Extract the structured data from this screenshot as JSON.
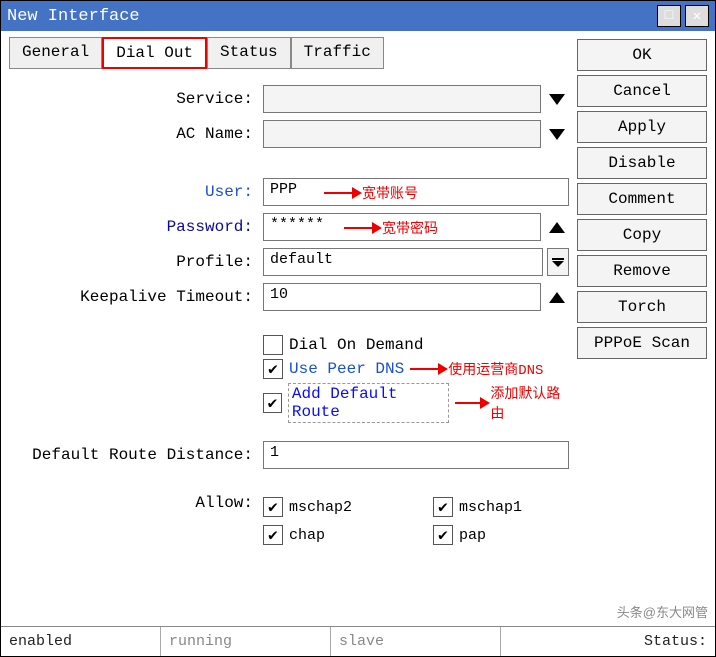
{
  "title": "New Interface",
  "tabs": [
    "General",
    "Dial Out",
    "Status",
    "Traffic"
  ],
  "active_tab": "Dial Out",
  "fields": {
    "service_label": "Service:",
    "service_value": "",
    "acname_label": "AC Name:",
    "acname_value": "",
    "user_label": "User:",
    "user_value": "PPP",
    "password_label": "Password:",
    "password_value": "******",
    "profile_label": "Profile:",
    "profile_value": "default",
    "keepalive_label": "Keepalive Timeout:",
    "keepalive_value": "10",
    "default_route_distance_label": "Default Route Distance:",
    "default_route_distance_value": "1",
    "allow_label": "Allow:"
  },
  "checkboxes": {
    "dial_on_demand": {
      "label": "Dial On Demand",
      "checked": false
    },
    "use_peer_dns": {
      "label": "Use Peer DNS",
      "checked": true
    },
    "add_default_route": {
      "label": "Add Default Route",
      "checked": true
    }
  },
  "allow": {
    "mschap2": {
      "label": "mschap2",
      "checked": true
    },
    "mschap1": {
      "label": "mschap1",
      "checked": true
    },
    "chap": {
      "label": "chap",
      "checked": true
    },
    "pap": {
      "label": "pap",
      "checked": true
    }
  },
  "annotations": {
    "user": "宽带账号",
    "password": "宽带密码",
    "use_peer_dns": "使用运营商DNS",
    "add_default_route": "添加默认路由"
  },
  "buttons": [
    "OK",
    "Cancel",
    "Apply",
    "Disable",
    "Comment",
    "Copy",
    "Remove",
    "Torch",
    "PPPoE Scan"
  ],
  "status": {
    "c1": "enabled",
    "c2": "running",
    "c3": "slave",
    "right": "Status:"
  },
  "watermark": "头条@东大网管"
}
